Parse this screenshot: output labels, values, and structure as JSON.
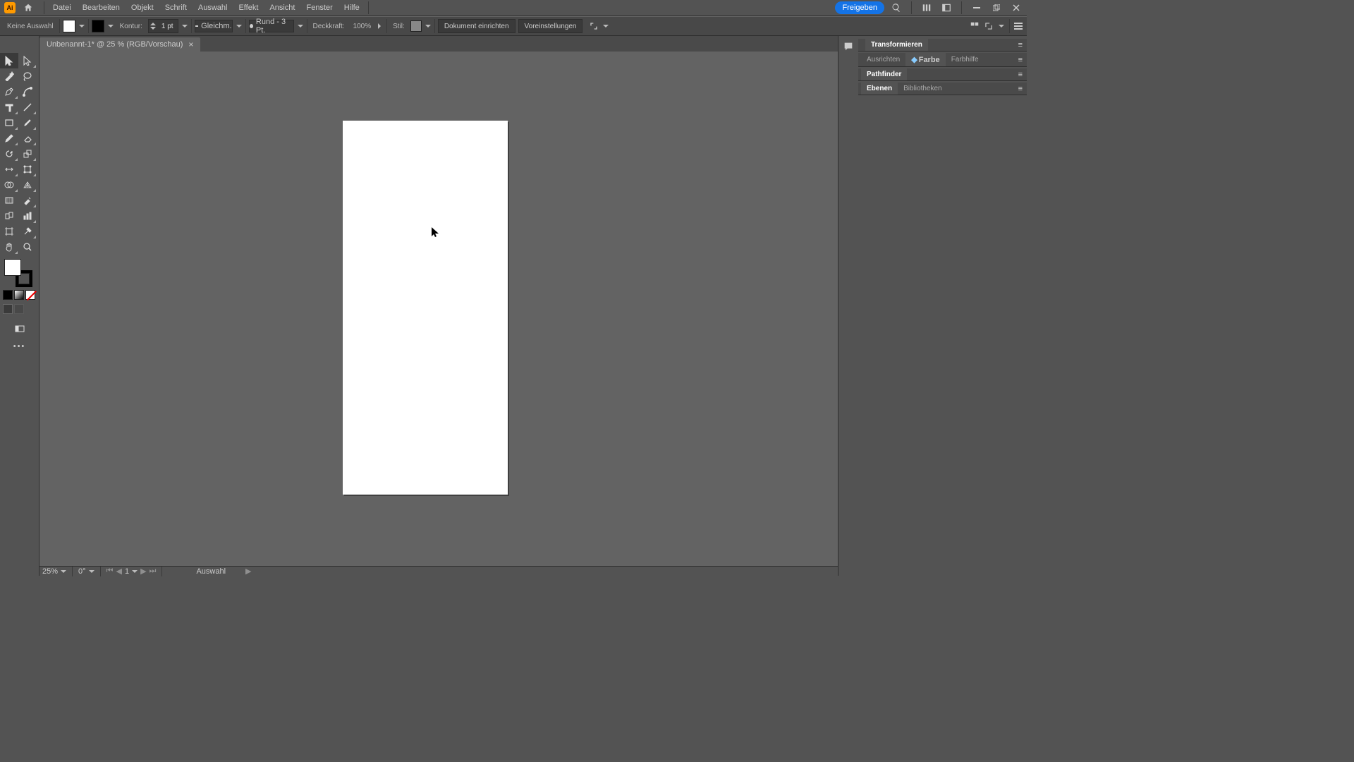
{
  "menu": {
    "app_abbr": "Ai",
    "items": [
      "Datei",
      "Bearbeiten",
      "Objekt",
      "Schrift",
      "Auswahl",
      "Effekt",
      "Ansicht",
      "Fenster",
      "Hilfe"
    ],
    "share_label": "Freigeben"
  },
  "control": {
    "no_selection": "Keine Auswahl",
    "stroke_label": "Kontur:",
    "stroke_weight": "1 pt",
    "stroke_profile": "Gleichm.",
    "brush_label": "Rund - 3 Pt.",
    "opacity_label": "Deckkraft:",
    "opacity_value": "100%",
    "style_label": "Stil:",
    "doc_setup": "Dokument einrichten",
    "prefs": "Voreinstellungen"
  },
  "tab": {
    "title": "Unbenannt-1* @ 25 % (RGB/Vorschau)"
  },
  "panels": {
    "transform": "Transformieren",
    "align": "Ausrichten",
    "color": "Farbe",
    "color_guide": "Farbhilfe",
    "pathfinder": "Pathfinder",
    "layers": "Ebenen",
    "libraries": "Bibliotheken"
  },
  "status": {
    "zoom": "25%",
    "rotate": "0°",
    "artboard": "1",
    "tool": "Auswahl"
  }
}
